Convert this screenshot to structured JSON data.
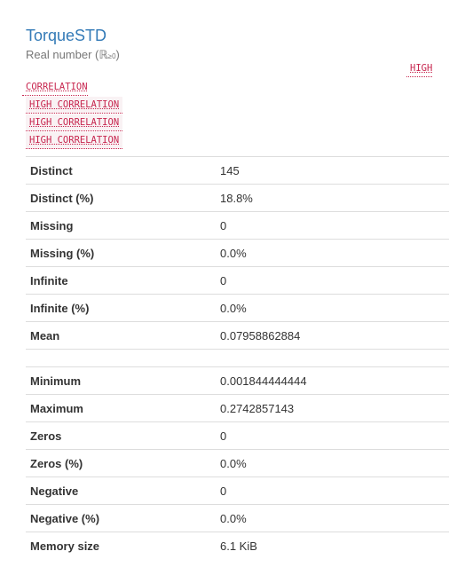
{
  "variable": {
    "name": "TorqueSTD",
    "type_label": "Real number (",
    "type_symbol": "ℝ",
    "type_subscript": "≥0",
    "type_close": ")"
  },
  "alerts": {
    "high_top": "HIGH",
    "correlation": "CORRELATION",
    "rows": [
      "HIGH CORRELATION",
      "HIGH CORRELATION",
      "HIGH CORRELATION"
    ]
  },
  "stats_group1": [
    {
      "label": "Distinct",
      "value": "145"
    },
    {
      "label": "Distinct (%)",
      "value": "18.8%"
    },
    {
      "label": "Missing",
      "value": "0"
    },
    {
      "label": "Missing (%)",
      "value": "0.0%"
    },
    {
      "label": "Infinite",
      "value": "0"
    },
    {
      "label": "Infinite (%)",
      "value": "0.0%"
    },
    {
      "label": "Mean",
      "value": "0.07958862884"
    }
  ],
  "stats_group2": [
    {
      "label": "Minimum",
      "value": "0.001844444444"
    },
    {
      "label": "Maximum",
      "value": "0.2742857143"
    },
    {
      "label": "Zeros",
      "value": "0"
    },
    {
      "label": "Zeros (%)",
      "value": "0.0%"
    },
    {
      "label": "Negative",
      "value": "0"
    },
    {
      "label": "Negative (%)",
      "value": "0.0%"
    },
    {
      "label": "Memory size",
      "value": "6.1 KiB"
    }
  ],
  "colors": {
    "title_link": "#337ab7",
    "badge_text": "#c7254e",
    "badge_bg": "#f9f2f4",
    "row_border": "#dddddd"
  }
}
